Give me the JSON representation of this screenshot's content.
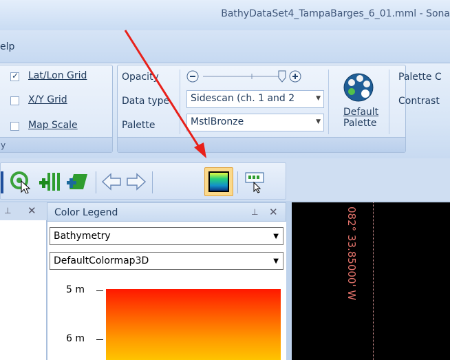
{
  "window": {
    "title": "BathyDataSet4_TampaBarges_6_01.mml - Sona"
  },
  "menu": {
    "help": "elp"
  },
  "ribbon": {
    "group1": {
      "label": "y",
      "items": [
        {
          "label": "Lat/Lon Grid",
          "checked": true
        },
        {
          "label": "X/Y Grid",
          "checked": false
        },
        {
          "label": "Map Scale",
          "checked": false
        }
      ]
    },
    "group2": {
      "opacity_label": "Opacity",
      "data_type_label": "Data type",
      "palette_label": "Palette",
      "data_type_value": "Sidescan (ch. 1 and 2",
      "palette_value": "MstlBronze",
      "default_palette_label_1": "Default",
      "default_palette_label_2": "Palette",
      "palette_c_label": "Palette C",
      "contrast_label": "Contrast"
    }
  },
  "panels": {
    "legend": {
      "title": "Color Legend",
      "layer_value": "Bathymetry",
      "colormap_value": "DefaultColormap3D",
      "ticks": [
        "5 m",
        "6 m"
      ]
    }
  },
  "map": {
    "coordinate": "082° 33.85000' W"
  },
  "colors": {
    "arrow": "#e8201a",
    "map_text": "#e2726a"
  }
}
